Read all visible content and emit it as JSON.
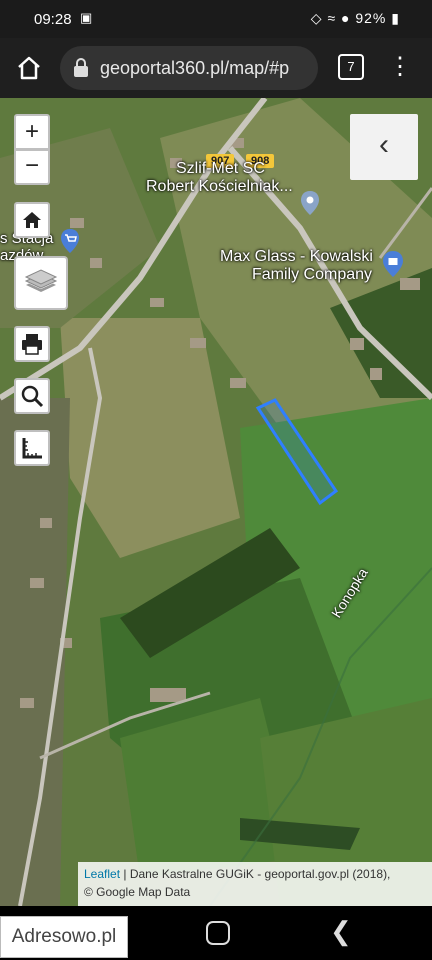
{
  "status_bar": {
    "time": "09:28",
    "battery": "92%"
  },
  "browser": {
    "url": "geoportal360.pl/map/#p",
    "tab_count": "7"
  },
  "map": {
    "labels": {
      "road_907": "907",
      "road_908": "908",
      "poi_1_line1": "Szlif-Met SC",
      "poi_1_line2": "Robert Kościelniak...",
      "poi_2_line1": "Max Glass - Kowalski",
      "poi_2_line2": "Family Company",
      "poi_3_line1": "s Stacja",
      "poi_3_line2": "azdów",
      "stream": "Konopka"
    },
    "controls": {
      "zoom_in": "+",
      "zoom_out": "−",
      "panel_toggle": "‹"
    },
    "attribution": {
      "leaflet": "Leaflet",
      "rest": " | Dane Kastralne GUGiK - geoportal.gov.pl (2018),",
      "line2": "© Google Map Data"
    },
    "parcel_color": "#2f7fff"
  },
  "watermark": "Adresowo.pl"
}
